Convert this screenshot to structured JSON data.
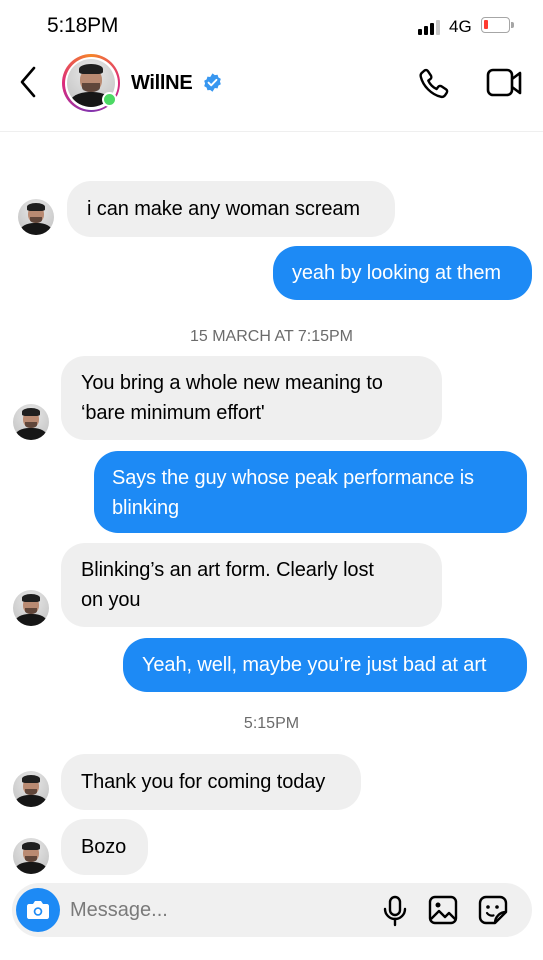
{
  "status_bar": {
    "time": "5:18PM",
    "network": "4G",
    "battery_level": 0.08,
    "battery_color": "#ff3b30"
  },
  "header": {
    "contact_name": "WillNE",
    "verified": true,
    "online": true,
    "icons": [
      "back-chevron-icon",
      "verified-badge-icon",
      "phone-icon",
      "video-camera-icon"
    ]
  },
  "messages": [
    {
      "direction": "in",
      "text": "i can make any woman scream"
    },
    {
      "direction": "out",
      "text": "yeah by looking at them"
    },
    {
      "type": "timestamp",
      "text": "15 MARCH AT 7:15PM"
    },
    {
      "direction": "in",
      "lines": [
        "You bring a whole new meaning to",
        "‘bare minimum effort'"
      ]
    },
    {
      "direction": "out",
      "lines": [
        "Says the guy whose peak performance is",
        "blinking"
      ]
    },
    {
      "direction": "in",
      "lines": [
        "Blinking’s an art form. Clearly lost",
        "on you"
      ]
    },
    {
      "direction": "out",
      "text": "Yeah, well, maybe you’re just bad at art"
    },
    {
      "type": "timestamp",
      "text": "5:15PM"
    },
    {
      "direction": "in",
      "text": "Thank you for coming today"
    },
    {
      "direction": "in",
      "text": "Bozo"
    }
  ],
  "composer": {
    "placeholder": "Message...",
    "icons": [
      "camera-icon",
      "microphone-icon",
      "gallery-icon",
      "sticker-icon"
    ]
  },
  "colors": {
    "outgoing_bubble": "#1d8af5",
    "incoming_bubble": "#efefef",
    "online": "#4cd964",
    "verified": "#3897f0"
  }
}
